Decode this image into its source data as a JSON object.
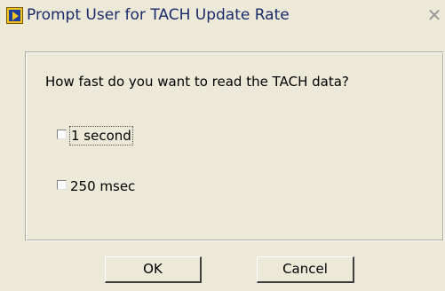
{
  "window": {
    "title": "Prompt User for TACH Update Rate",
    "icon": "labview-app-icon",
    "close_glyph": "✕"
  },
  "dialog": {
    "question": "How fast do you want to read  the TACH data?",
    "options": [
      {
        "label": "1 second",
        "checked": false,
        "focused": true
      },
      {
        "label": "250 msec",
        "checked": false,
        "focused": false
      }
    ]
  },
  "buttons": {
    "ok_label": "OK",
    "cancel_label": "Cancel"
  }
}
